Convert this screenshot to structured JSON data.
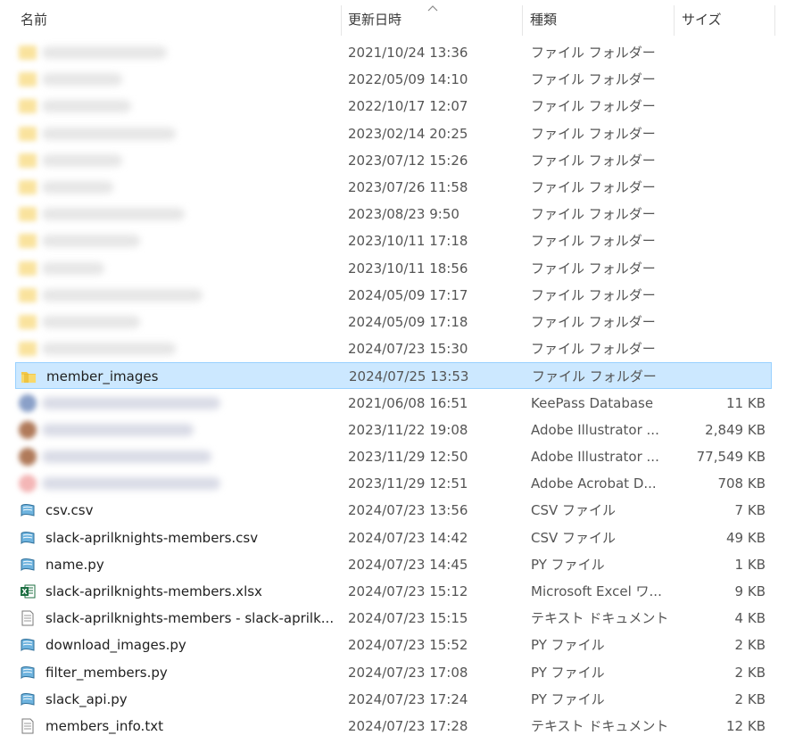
{
  "columns": {
    "name": "名前",
    "date": "更新日時",
    "type": "種類",
    "size": "サイズ"
  },
  "rows": [
    {
      "name": "",
      "date": "2021/10/24 13:36",
      "type": "ファイル フォルダー",
      "size": "",
      "icon": "folder-icon",
      "blurred": true
    },
    {
      "name": "",
      "date": "2022/05/09 14:10",
      "type": "ファイル フォルダー",
      "size": "",
      "icon": "folder-icon",
      "blurred": true
    },
    {
      "name": "",
      "date": "2022/10/17 12:07",
      "type": "ファイル フォルダー",
      "size": "",
      "icon": "folder-icon",
      "blurred": true
    },
    {
      "name": "",
      "date": "2023/02/14 20:25",
      "type": "ファイル フォルダー",
      "size": "",
      "icon": "folder-icon",
      "blurred": true
    },
    {
      "name": "",
      "date": "2023/07/12 15:26",
      "type": "ファイル フォルダー",
      "size": "",
      "icon": "folder-icon",
      "blurred": true
    },
    {
      "name": "",
      "date": "2023/07/26 11:58",
      "type": "ファイル フォルダー",
      "size": "",
      "icon": "folder-icon",
      "blurred": true
    },
    {
      "name": "",
      "date": "2023/08/23 9:50",
      "type": "ファイル フォルダー",
      "size": "",
      "icon": "folder-icon",
      "blurred": true
    },
    {
      "name": "",
      "date": "2023/10/11 17:18",
      "type": "ファイル フォルダー",
      "size": "",
      "icon": "folder-icon",
      "blurred": true
    },
    {
      "name": "",
      "date": "2023/10/11 18:56",
      "type": "ファイル フォルダー",
      "size": "",
      "icon": "folder-icon",
      "blurred": true
    },
    {
      "name": "",
      "date": "2024/05/09 17:17",
      "type": "ファイル フォルダー",
      "size": "",
      "icon": "folder-icon",
      "blurred": true
    },
    {
      "name": "",
      "date": "2024/05/09 17:18",
      "type": "ファイル フォルダー",
      "size": "",
      "icon": "folder-icon",
      "blurred": true
    },
    {
      "name": "",
      "date": "2024/07/23 15:30",
      "type": "ファイル フォルダー",
      "size": "",
      "icon": "folder-icon",
      "blurred": true
    },
    {
      "name": "member_images",
      "date": "2024/07/25 13:53",
      "type": "ファイル フォルダー",
      "size": "",
      "icon": "folder-icon",
      "selected": true
    },
    {
      "name": "",
      "date": "2021/06/08 16:51",
      "type": "KeePass Database",
      "size": "11 KB",
      "icon": "keepass-icon",
      "blurred": true
    },
    {
      "name": "",
      "date": "2023/11/22 19:08",
      "type": "Adobe Illustrator ...",
      "size": "2,849 KB",
      "icon": "illustrator-icon",
      "blurred": true
    },
    {
      "name": "",
      "date": "2023/11/29 12:50",
      "type": "Adobe Illustrator ...",
      "size": "77,549 KB",
      "icon": "illustrator-icon",
      "blurred": true
    },
    {
      "name": "",
      "date": "2023/11/29 12:51",
      "type": "Adobe Acrobat D...",
      "size": "708 KB",
      "icon": "pdf-icon",
      "blurred": true
    },
    {
      "name": "csv.csv",
      "date": "2024/07/23 13:56",
      "type": "CSV ファイル",
      "size": "7 KB",
      "icon": "script-file-icon"
    },
    {
      "name": "slack-aprilknights-members.csv",
      "date": "2024/07/23 14:42",
      "type": "CSV ファイル",
      "size": "49 KB",
      "icon": "script-file-icon"
    },
    {
      "name": "name.py",
      "date": "2024/07/23 14:45",
      "type": "PY ファイル",
      "size": "1 KB",
      "icon": "script-file-icon"
    },
    {
      "name": "slack-aprilknights-members.xlsx",
      "date": "2024/07/23 15:12",
      "type": "Microsoft Excel ワ...",
      "size": "9 KB",
      "icon": "excel-icon"
    },
    {
      "name": "slack-aprilknights-members - slack-aprilk...",
      "date": "2024/07/23 15:15",
      "type": "テキスト ドキュメント",
      "size": "4 KB",
      "icon": "text-file-icon"
    },
    {
      "name": "download_images.py",
      "date": "2024/07/23 15:52",
      "type": "PY ファイル",
      "size": "2 KB",
      "icon": "script-file-icon"
    },
    {
      "name": "filter_members.py",
      "date": "2024/07/23 17:08",
      "type": "PY ファイル",
      "size": "2 KB",
      "icon": "script-file-icon"
    },
    {
      "name": "slack_api.py",
      "date": "2024/07/23 17:24",
      "type": "PY ファイル",
      "size": "2 KB",
      "icon": "script-file-icon"
    },
    {
      "name": "members_info.txt",
      "date": "2024/07/23 17:28",
      "type": "テキスト ドキュメント",
      "size": "12 KB",
      "icon": "text-file-icon"
    }
  ],
  "colors": {
    "selected_bg": "#cce8ff",
    "selected_border": "#99d1ff",
    "folder": "#f2c94c",
    "excel": "#1d6f42"
  }
}
